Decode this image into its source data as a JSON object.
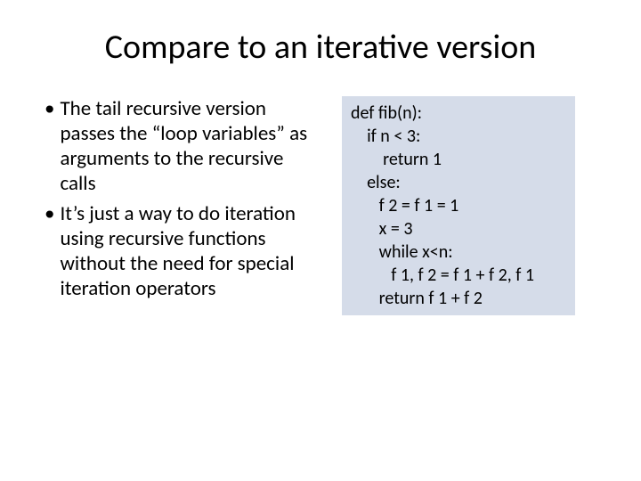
{
  "title": "Compare to an iterative version",
  "bullets": [
    "The tail recursive version passes the “loop variables” as arguments to the recursive calls",
    "It’s just a way to do iteration using recursive functions without the need for special iteration operators"
  ],
  "code": "def fib(n):\n    if n < 3:\n        return 1\n    else:\n       f 2 = f 1 = 1\n       x = 3\n       while x<n:\n          f 1, f 2 = f 1 + f 2, f 1\n       return f 1 + f 2"
}
